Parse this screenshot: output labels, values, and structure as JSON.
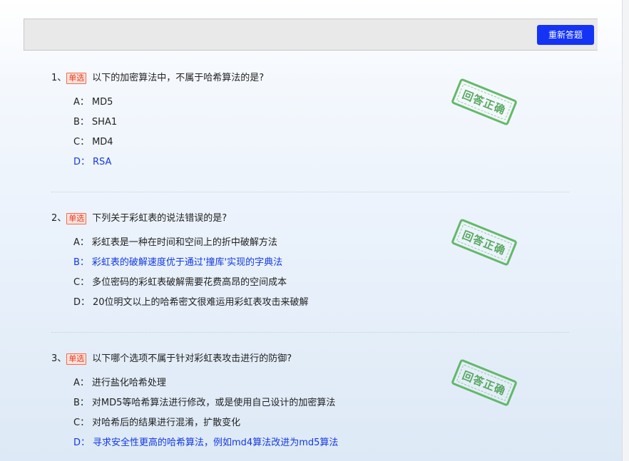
{
  "toolbar": {
    "redo_label": "重新答题"
  },
  "stamp_text": "回答正确",
  "questions": [
    {
      "num": "1、",
      "type": "单选",
      "text": "以下的加密算法中，不属于哈希算法的是?",
      "options": [
        {
          "letter": "A：",
          "text": "MD5",
          "correct": false
        },
        {
          "letter": "B：",
          "text": "SHA1",
          "correct": false
        },
        {
          "letter": "C：",
          "text": "MD4",
          "correct": false
        },
        {
          "letter": "D：",
          "text": "RSA",
          "correct": true
        }
      ]
    },
    {
      "num": "2、",
      "type": "单选",
      "text": "下列关于彩虹表的说法错误的是?",
      "options": [
        {
          "letter": "A：",
          "text": "彩虹表是一种在时间和空间上的折中破解方法",
          "correct": false
        },
        {
          "letter": "B：",
          "text": "彩虹表的破解速度优于通过'撞库'实现的字典法",
          "correct": true
        },
        {
          "letter": "C：",
          "text": "多位密码的彩虹表破解需要花费高昂的空间成本",
          "correct": false
        },
        {
          "letter": "D：",
          "text": "20位明文以上的哈希密文很难运用彩虹表攻击来破解",
          "correct": false
        }
      ]
    },
    {
      "num": "3、",
      "type": "单选",
      "text": "以下哪个选项不属于针对彩虹表攻击进行的防御?",
      "options": [
        {
          "letter": "A：",
          "text": "进行盐化哈希处理",
          "correct": false
        },
        {
          "letter": "B：",
          "text": "对MD5等哈希算法进行修改，或是使用自己设计的加密算法",
          "correct": false
        },
        {
          "letter": "C：",
          "text": "对哈希后的结果进行混淆，扩散变化",
          "correct": false
        },
        {
          "letter": "D：",
          "text": "寻求安全性更高的哈希算法，例如md4算法改进为md5算法",
          "correct": true
        }
      ]
    }
  ],
  "colors": {
    "accent": "#1433f5",
    "correct": "#1238e3",
    "stamp": "#4caf50",
    "badge": "#e53b1f"
  }
}
